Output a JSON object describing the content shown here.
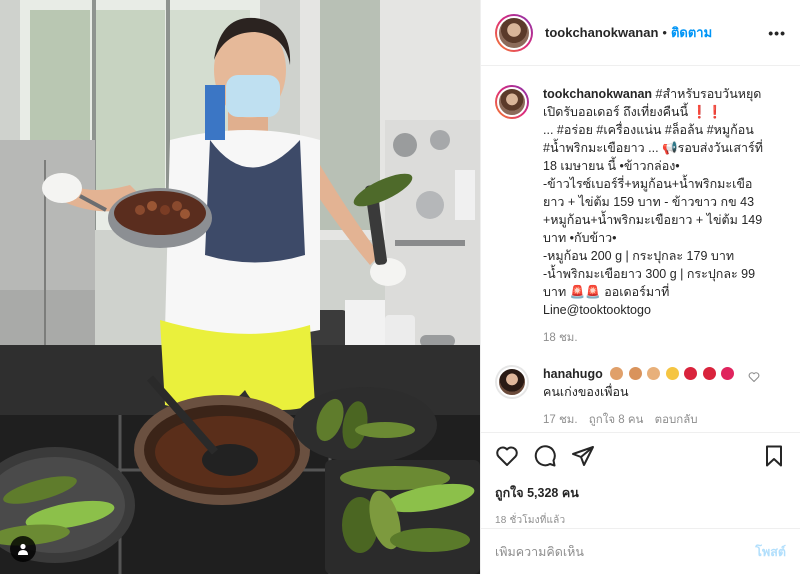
{
  "post": {
    "username": "tookchanokwanan",
    "separator": "•",
    "follow_label": "ติดตาม",
    "more_label": "•••"
  },
  "caption": {
    "username": "tookchanokwanan",
    "text": "#สำหรับรอบวันหยุด\nเปิดรับออเดอร์ ถึงเที่ยงคืนนี้ ❗❗\n... #อร่อย #เครื่องแน่น #ล็อล้น #หมูก้อน\n#น้ำพริกมะเขือยาว ... 📢รอบส่งวันเสาร์ที่\n18 เมษายน นี้ •ข้าวกล่อง•\n-ข้าวไรซ์เบอร์รี่+หมูก้อน+น้ำพริกมะเขือ\nยาว + ไข่ต้ม 159 บาท - ข้าวขาว กข 43\n+หมูก้อน+น้ำพริกมะเขือยาว + ไข่ต้ม 149\nบาท •กับข้าว•\n-หมูก้อน 200 g | กระปุกละ 179 บาท\n-น้ำพริกมะเขือยาว 300 g | กระปุกละ 99\nบาท 🚨🚨 ออเดอร์มาที่\nLine@tooktooktogo",
    "time": "18 ชม."
  },
  "reply": {
    "username": "hanahugo",
    "text": "คนเก่งของเพื่อน",
    "time": "17 ชม.",
    "likes": "ถูกใจ 8 คน",
    "reply_label": "ตอบกลับ"
  },
  "likes": {
    "label": "ถูกใจ",
    "count": "5,328",
    "unit": "คน"
  },
  "timestamp": "18 ชั่วโมงที่แล้ว",
  "comment_box": {
    "placeholder": "เพิ่มความคิดเห็น",
    "post_label": "โพสต์"
  },
  "icons": {
    "like": "heart-icon",
    "comment": "comment-icon",
    "share": "paper-plane-icon",
    "save": "bookmark-icon",
    "comment_like": "heart-icon",
    "tagged_user": "user-icon"
  },
  "colors": {
    "accent": "#0095f6",
    "text": "#262626",
    "muted": "#8e8e8e",
    "post_disabled": "#b2dffc"
  }
}
